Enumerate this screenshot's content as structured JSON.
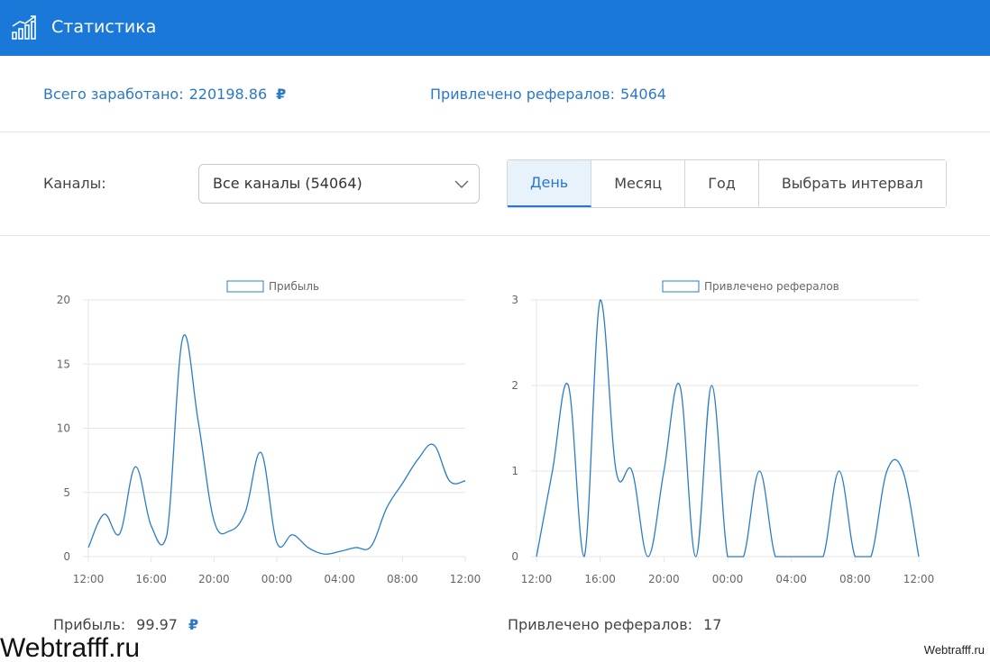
{
  "header": {
    "title": "Статистика",
    "icon": "stats-chart-icon"
  },
  "totals": {
    "earned_label": "Всего заработано:",
    "earned_value": "220198.86",
    "currency_symbol": "₽",
    "referrals_label": "Привлечено рефералов:",
    "referrals_value": "54064"
  },
  "filters": {
    "channels_label": "Каналы:",
    "channel_selected": "Все каналы (54064)",
    "periods": [
      "День",
      "Месяц",
      "Год",
      "Выбрать интервал"
    ],
    "active_period": "День"
  },
  "colors": {
    "accent": "#1a78d8",
    "line": "#2b7cc8",
    "grid": "#e6e6e6"
  },
  "chart_data": [
    {
      "type": "line",
      "legend": "Прибыль",
      "x_ticks": [
        "12:00",
        "16:00",
        "20:00",
        "00:00",
        "04:00",
        "08:00",
        "12:00"
      ],
      "x_hours": [
        0,
        24
      ],
      "ylim": [
        0,
        20
      ],
      "y_ticks": [
        0,
        5,
        10,
        15,
        20
      ],
      "grid": true,
      "legend_position": "top",
      "series": [
        {
          "name": "Прибыль",
          "x": [
            0,
            1,
            2,
            3,
            4,
            5,
            6,
            7,
            8,
            9,
            10,
            11,
            12,
            13,
            14,
            15,
            16,
            17,
            18,
            19,
            20,
            21,
            22,
            23,
            24
          ],
          "values": [
            0.7,
            3.3,
            1.8,
            7.0,
            2.4,
            1.7,
            17.0,
            10.5,
            2.8,
            2.0,
            3.5,
            8.1,
            1.1,
            1.7,
            0.7,
            0.2,
            0.4,
            0.7,
            0.8,
            3.8,
            5.7,
            7.6,
            8.7,
            5.9,
            5.9
          ]
        }
      ]
    },
    {
      "type": "line",
      "legend": "Привлечено рефералов",
      "x_ticks": [
        "12:00",
        "16:00",
        "20:00",
        "00:00",
        "04:00",
        "08:00",
        "12:00"
      ],
      "x_hours": [
        0,
        24
      ],
      "ylim": [
        0,
        3
      ],
      "y_ticks": [
        0,
        1,
        2,
        3
      ],
      "grid": true,
      "legend_position": "top",
      "series": [
        {
          "name": "Привлечено рефералов",
          "x": [
            0,
            1,
            2,
            3,
            4,
            5,
            6,
            7,
            8,
            9,
            10,
            11,
            12,
            13,
            14,
            15,
            16,
            17,
            18,
            19,
            20,
            21,
            22,
            23,
            24
          ],
          "values": [
            0,
            1,
            2,
            0,
            3,
            1,
            1,
            0,
            1,
            2,
            0,
            2,
            0,
            0,
            1,
            0,
            0,
            0,
            0,
            1,
            0,
            0,
            1,
            1,
            0
          ]
        }
      ]
    }
  ],
  "summary": {
    "profit_label": "Прибыль:",
    "profit_value": "99.97",
    "referrals_label": "Привлечено рефералов:",
    "referrals_value": "17"
  },
  "watermark": {
    "left": "Webtrafff.ru",
    "right": "Webtrafff.ru"
  }
}
